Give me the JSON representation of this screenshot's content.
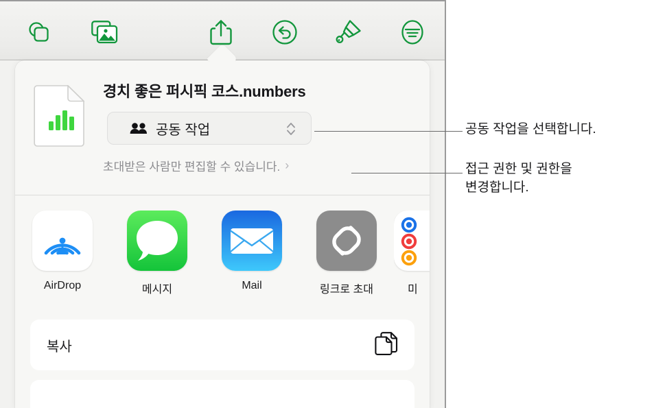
{
  "toolbar": {
    "buttons": [
      {
        "name": "insert-shape-icon",
        "label": "도형"
      },
      {
        "name": "insert-media-icon",
        "label": "미디어"
      },
      {
        "name": "share-icon",
        "label": "공유"
      },
      {
        "name": "undo-icon",
        "label": "실행 취소"
      },
      {
        "name": "format-brush-icon",
        "label": "포맷"
      },
      {
        "name": "document-options-icon",
        "label": "도큐먼트 옵션"
      }
    ]
  },
  "popover": {
    "document_title": "경치 좋은 퍼시픽 코스.numbers",
    "file_icon": "numbers-document-icon",
    "collaboration": {
      "icon": "two-people-icon",
      "label": "공동 작업",
      "chevron_icon": "chevron-up-down-icon"
    },
    "permission": {
      "text": "초대받은 사람만 편집할 수 있습니다.",
      "chevron_icon": "chevron-right-icon"
    },
    "share_targets": [
      {
        "name": "airdrop",
        "label": "AirDrop",
        "icon": "airdrop-icon"
      },
      {
        "name": "messages",
        "label": "메시지",
        "icon": "messages-icon"
      },
      {
        "name": "mail",
        "label": "Mail",
        "icon": "mail-icon"
      },
      {
        "name": "copy-link",
        "label": "링크로 초대",
        "icon": "link-icon"
      },
      {
        "name": "reminders",
        "label": "미",
        "icon": "reminders-icon"
      }
    ],
    "copy_action": {
      "label": "복사",
      "icon": "duplicate-documents-icon"
    }
  },
  "callouts": [
    {
      "name": "callout-collaboration",
      "text": "공동 작업을 선택합니다."
    },
    {
      "name": "callout-permissions",
      "text": "접근 권한 및 권한을\n변경합니다."
    }
  ],
  "colors": {
    "toolbar_icon_green": "#12963c",
    "messages_green": "#32c84a",
    "mail_blue": "#1d8ef5",
    "link_gray": "#8c8c8c",
    "airdrop_blue": "#1d8ef5",
    "reminder_blue": "#1a72e8",
    "reminder_red": "#f03d3d",
    "reminder_orange": "#fca00c"
  }
}
